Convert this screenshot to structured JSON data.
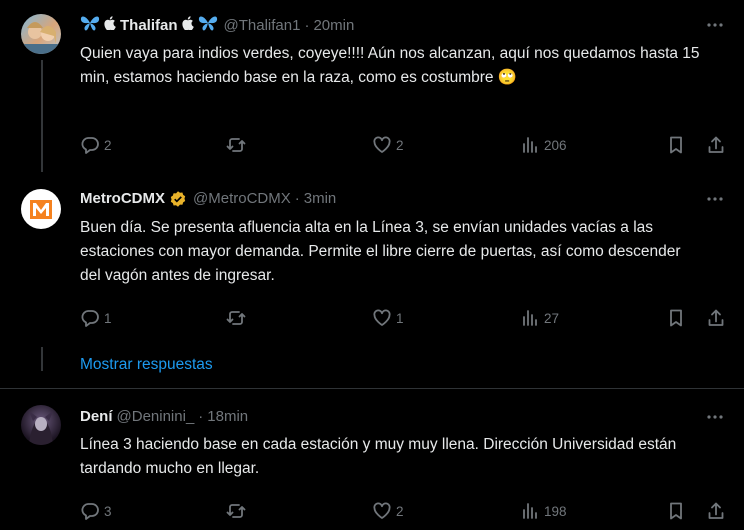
{
  "tweets": [
    {
      "display_name": "Thalifan",
      "handle": "@Thalifan1",
      "dot": "·",
      "time": "20min",
      "text": "Quien vaya para indios verdes, coyeye!!!! Aún nos alcanzan, aquí nos quedamos hasta 15 min, estamos haciendo base en la raza, como es costumbre 🙄",
      "replies": "2",
      "retweets": "",
      "likes": "2",
      "views": "206"
    },
    {
      "display_name": "MetroCDMX",
      "handle": "@MetroCDMX",
      "dot": "·",
      "time": "3min",
      "text": "Buen día. Se presenta afluencia alta en la Línea 3, se envían unidades vacías a las estaciones con mayor demanda. Permite el libre cierre de puertas, así como descender del vagón antes de ingresar.",
      "replies": "1",
      "retweets": "",
      "likes": "1",
      "views": "27"
    },
    {
      "display_name": "Dení",
      "handle": "@Deninini_",
      "dot": "·",
      "time": "18min",
      "text": "Línea 3 haciendo base en cada estación y muy muy llena. Dirección Universidad están tardando mucho en llegar.",
      "replies": "3",
      "retweets": "",
      "likes": "2",
      "views": "198"
    }
  ],
  "show_replies": "Mostrar respuestas",
  "colors": {
    "background": "#000000",
    "text": "#e7e9ea",
    "secondary": "#71767b",
    "link": "#1d9bf0",
    "verified_gold": "#e8b22a",
    "metro_orange": "#f5821f"
  },
  "icons": [
    "butterfly-icon",
    "apple-icon",
    "verified-badge-icon",
    "reply-icon",
    "retweet-icon",
    "like-icon",
    "views-icon",
    "bookmark-icon",
    "share-icon",
    "more-icon"
  ]
}
